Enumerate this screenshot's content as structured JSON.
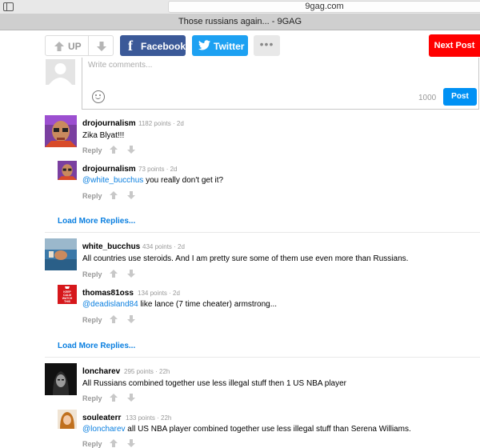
{
  "browser": {
    "url": "9gag.com",
    "tab_title": "Those russians again... - 9GAG"
  },
  "sharebar": {
    "up_label": "UP",
    "facebook_label": "Facebook",
    "twitter_label": "Twitter",
    "more_label": "•••",
    "next_post_label": "Next Post",
    "colors": {
      "facebook": "#3b5998",
      "twitter": "#1da1f2",
      "next_post": "#ff0000",
      "post": "#0091f4"
    }
  },
  "composer": {
    "placeholder": "Write comments...",
    "char_count": "1000",
    "post_label": "Post"
  },
  "comments": [
    {
      "user": "drojournalism",
      "meta": "1182 points · 2d",
      "mention": "",
      "text": "Zika Blyat!!!",
      "reply": "Reply"
    },
    {
      "user": "drojournalism",
      "meta": "73 points · 2d",
      "mention": "@white_bucchus",
      "text": " you really don't get it?",
      "reply": "Reply"
    },
    {
      "user": "white_bucchus",
      "meta": "434 points · 2d",
      "mention": "",
      "text": "All countries use steroids. And I am pretty sure some of them use even more than Russians.",
      "reply": "Reply"
    },
    {
      "user": "thomas81oss",
      "meta": "134 points · 2d",
      "mention": "@deadisland84",
      "text": " like lance (7 time cheater) armstrong...",
      "reply": "Reply"
    },
    {
      "user": "loncharev",
      "meta": "295 points · 22h",
      "mention": "",
      "text": "All Russians combined together use less illegal stuff then 1 US NBA player",
      "reply": "Reply"
    },
    {
      "user": "souleaterr",
      "meta": "133 points · 22h",
      "mention": "@loncharev",
      "text": " all US NBA player combined together use less illegal stuff than Serena Williams.",
      "reply": "Reply"
    }
  ],
  "load_more": [
    "Load More Replies...",
    "Load More Replies..."
  ],
  "avatar_text": "KEEP CALM AND WATCH THIS"
}
